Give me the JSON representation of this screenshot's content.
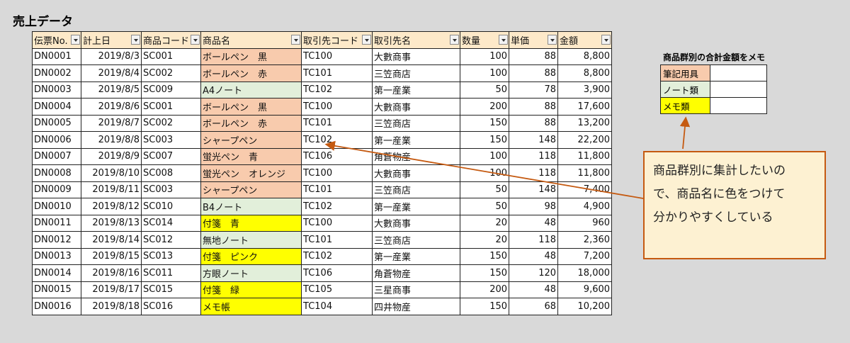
{
  "title": "売上データ",
  "table": {
    "headers": [
      "伝票No.",
      "計上日",
      "商品コード",
      "商品名",
      "取引先コード",
      "取引先名",
      "数量",
      "単価",
      "金額"
    ],
    "rows": [
      {
        "no": "DN0001",
        "date": "2019/8/3",
        "code": "SC001",
        "name": "ボールペン　黒",
        "cat": "pen",
        "client_code": "TC100",
        "client": "大數商事",
        "qty": "100",
        "price": "88",
        "amount": "8,800"
      },
      {
        "no": "DN0002",
        "date": "2019/8/4",
        "code": "SC002",
        "name": "ボールペン　赤",
        "cat": "pen",
        "client_code": "TC101",
        "client": "三笠商店",
        "qty": "100",
        "price": "88",
        "amount": "8,800"
      },
      {
        "no": "DN0003",
        "date": "2019/8/5",
        "code": "SC009",
        "name": "A4ノート",
        "cat": "note",
        "client_code": "TC102",
        "client": "第一産業",
        "qty": "50",
        "price": "78",
        "amount": "3,900"
      },
      {
        "no": "DN0004",
        "date": "2019/8/6",
        "code": "SC001",
        "name": "ボールペン　黒",
        "cat": "pen",
        "client_code": "TC100",
        "client": "大數商事",
        "qty": "200",
        "price": "88",
        "amount": "17,600"
      },
      {
        "no": "DN0005",
        "date": "2019/8/7",
        "code": "SC002",
        "name": "ボールペン　赤",
        "cat": "pen",
        "client_code": "TC101",
        "client": "三笠商店",
        "qty": "150",
        "price": "88",
        "amount": "13,200"
      },
      {
        "no": "DN0006",
        "date": "2019/8/8",
        "code": "SC003",
        "name": "シャープペン",
        "cat": "pen",
        "client_code": "TC102",
        "client": "第一産業",
        "qty": "150",
        "price": "148",
        "amount": "22,200"
      },
      {
        "no": "DN0007",
        "date": "2019/8/9",
        "code": "SC007",
        "name": "蛍光ペン　青",
        "cat": "pen",
        "client_code": "TC106",
        "client": "角蒼物産",
        "qty": "100",
        "price": "118",
        "amount": "11,800"
      },
      {
        "no": "DN0008",
        "date": "2019/8/10",
        "code": "SC008",
        "name": "蛍光ペン　オレンジ",
        "cat": "pen",
        "client_code": "TC100",
        "client": "大數商事",
        "qty": "100",
        "price": "118",
        "amount": "11,800"
      },
      {
        "no": "DN0009",
        "date": "2019/8/11",
        "code": "SC003",
        "name": "シャープペン",
        "cat": "pen",
        "client_code": "TC101",
        "client": "三笠商店",
        "qty": "50",
        "price": "148",
        "amount": "7,400"
      },
      {
        "no": "DN0010",
        "date": "2019/8/12",
        "code": "SC010",
        "name": "B4ノート",
        "cat": "note",
        "client_code": "TC102",
        "client": "第一産業",
        "qty": "50",
        "price": "98",
        "amount": "4,900"
      },
      {
        "no": "DN0011",
        "date": "2019/8/13",
        "code": "SC014",
        "name": "付箋　青",
        "cat": "memo",
        "client_code": "TC100",
        "client": "大數商事",
        "qty": "20",
        "price": "48",
        "amount": "960"
      },
      {
        "no": "DN0012",
        "date": "2019/8/14",
        "code": "SC012",
        "name": "無地ノート",
        "cat": "note",
        "client_code": "TC101",
        "client": "三笠商店",
        "qty": "20",
        "price": "118",
        "amount": "2,360"
      },
      {
        "no": "DN0013",
        "date": "2019/8/15",
        "code": "SC013",
        "name": "付箋　ピンク",
        "cat": "memo",
        "client_code": "TC102",
        "client": "第一産業",
        "qty": "150",
        "price": "48",
        "amount": "7,200"
      },
      {
        "no": "DN0014",
        "date": "2019/8/16",
        "code": "SC011",
        "name": "方眼ノート",
        "cat": "note",
        "client_code": "TC106",
        "client": "角蒼物産",
        "qty": "150",
        "price": "120",
        "amount": "18,000"
      },
      {
        "no": "DN0015",
        "date": "2019/8/17",
        "code": "SC015",
        "name": "付箋　緑",
        "cat": "memo",
        "client_code": "TC105",
        "client": "三星商事",
        "qty": "200",
        "price": "48",
        "amount": "9,600"
      },
      {
        "no": "DN0016",
        "date": "2019/8/18",
        "code": "SC016",
        "name": "メモ帳",
        "cat": "memo",
        "client_code": "TC104",
        "client": "四井物産",
        "qty": "150",
        "price": "68",
        "amount": "10,200"
      }
    ]
  },
  "summary": {
    "title": "商品群別の合計金額をメモ",
    "rows": [
      {
        "label": "筆記用具",
        "cat": "pen",
        "value": ""
      },
      {
        "label": "ノート類",
        "cat": "note",
        "value": ""
      },
      {
        "label": "メモ類",
        "cat": "memo",
        "value": ""
      }
    ]
  },
  "callout": {
    "lines": [
      "商品群別に集計したいの",
      "で、商品名に色をつけて",
      "分かりやすくしている"
    ]
  },
  "colors": {
    "header_bg": "#fde9c9",
    "pen": "#f8cbad",
    "note": "#e2efda",
    "memo": "#ffff00",
    "callout_border": "#c55a11",
    "callout_bg": "#fdf1d2"
  }
}
